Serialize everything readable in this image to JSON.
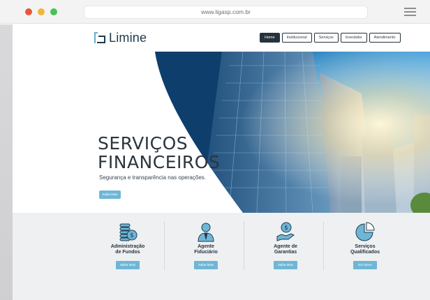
{
  "browser": {
    "url": "www.ligasp.com.br",
    "window_controls": [
      "close",
      "minimize",
      "maximize"
    ],
    "menu_icon": "hamburger-icon"
  },
  "site": {
    "logo_text": "Limine",
    "nav": [
      {
        "label": "Home",
        "active": true
      },
      {
        "label": "Institucional",
        "active": false
      },
      {
        "label": "Serviços",
        "active": false
      },
      {
        "label": "Investidor",
        "active": false
      },
      {
        "label": "Atendimento",
        "active": false
      }
    ]
  },
  "hero": {
    "title_line1": "SERVIÇOS",
    "title_line2": "FINANCEIROS",
    "subtitle": "Segurança e transparência nas operações.",
    "button": "Saiba Mais"
  },
  "services": [
    {
      "icon": "coins-stack-icon",
      "title_line1": "Administração",
      "title_line2": "de Fundos",
      "button": "Saiba Mais"
    },
    {
      "icon": "businessman-icon",
      "title_line1": "Agente",
      "title_line2": "Fiduciário",
      "button": "Saiba Mais"
    },
    {
      "icon": "hand-money-icon",
      "title_line1": "Agente de",
      "title_line2": "Garantias",
      "button": "Saiba Mais"
    },
    {
      "icon": "pie-chart-icon",
      "title_line1": "Serviços",
      "title_line2": "Qualificados",
      "button": "Em breve"
    }
  ],
  "colors": {
    "accent": "#6fb6d6",
    "dark": "#26333d",
    "band": "#eef0f1"
  }
}
